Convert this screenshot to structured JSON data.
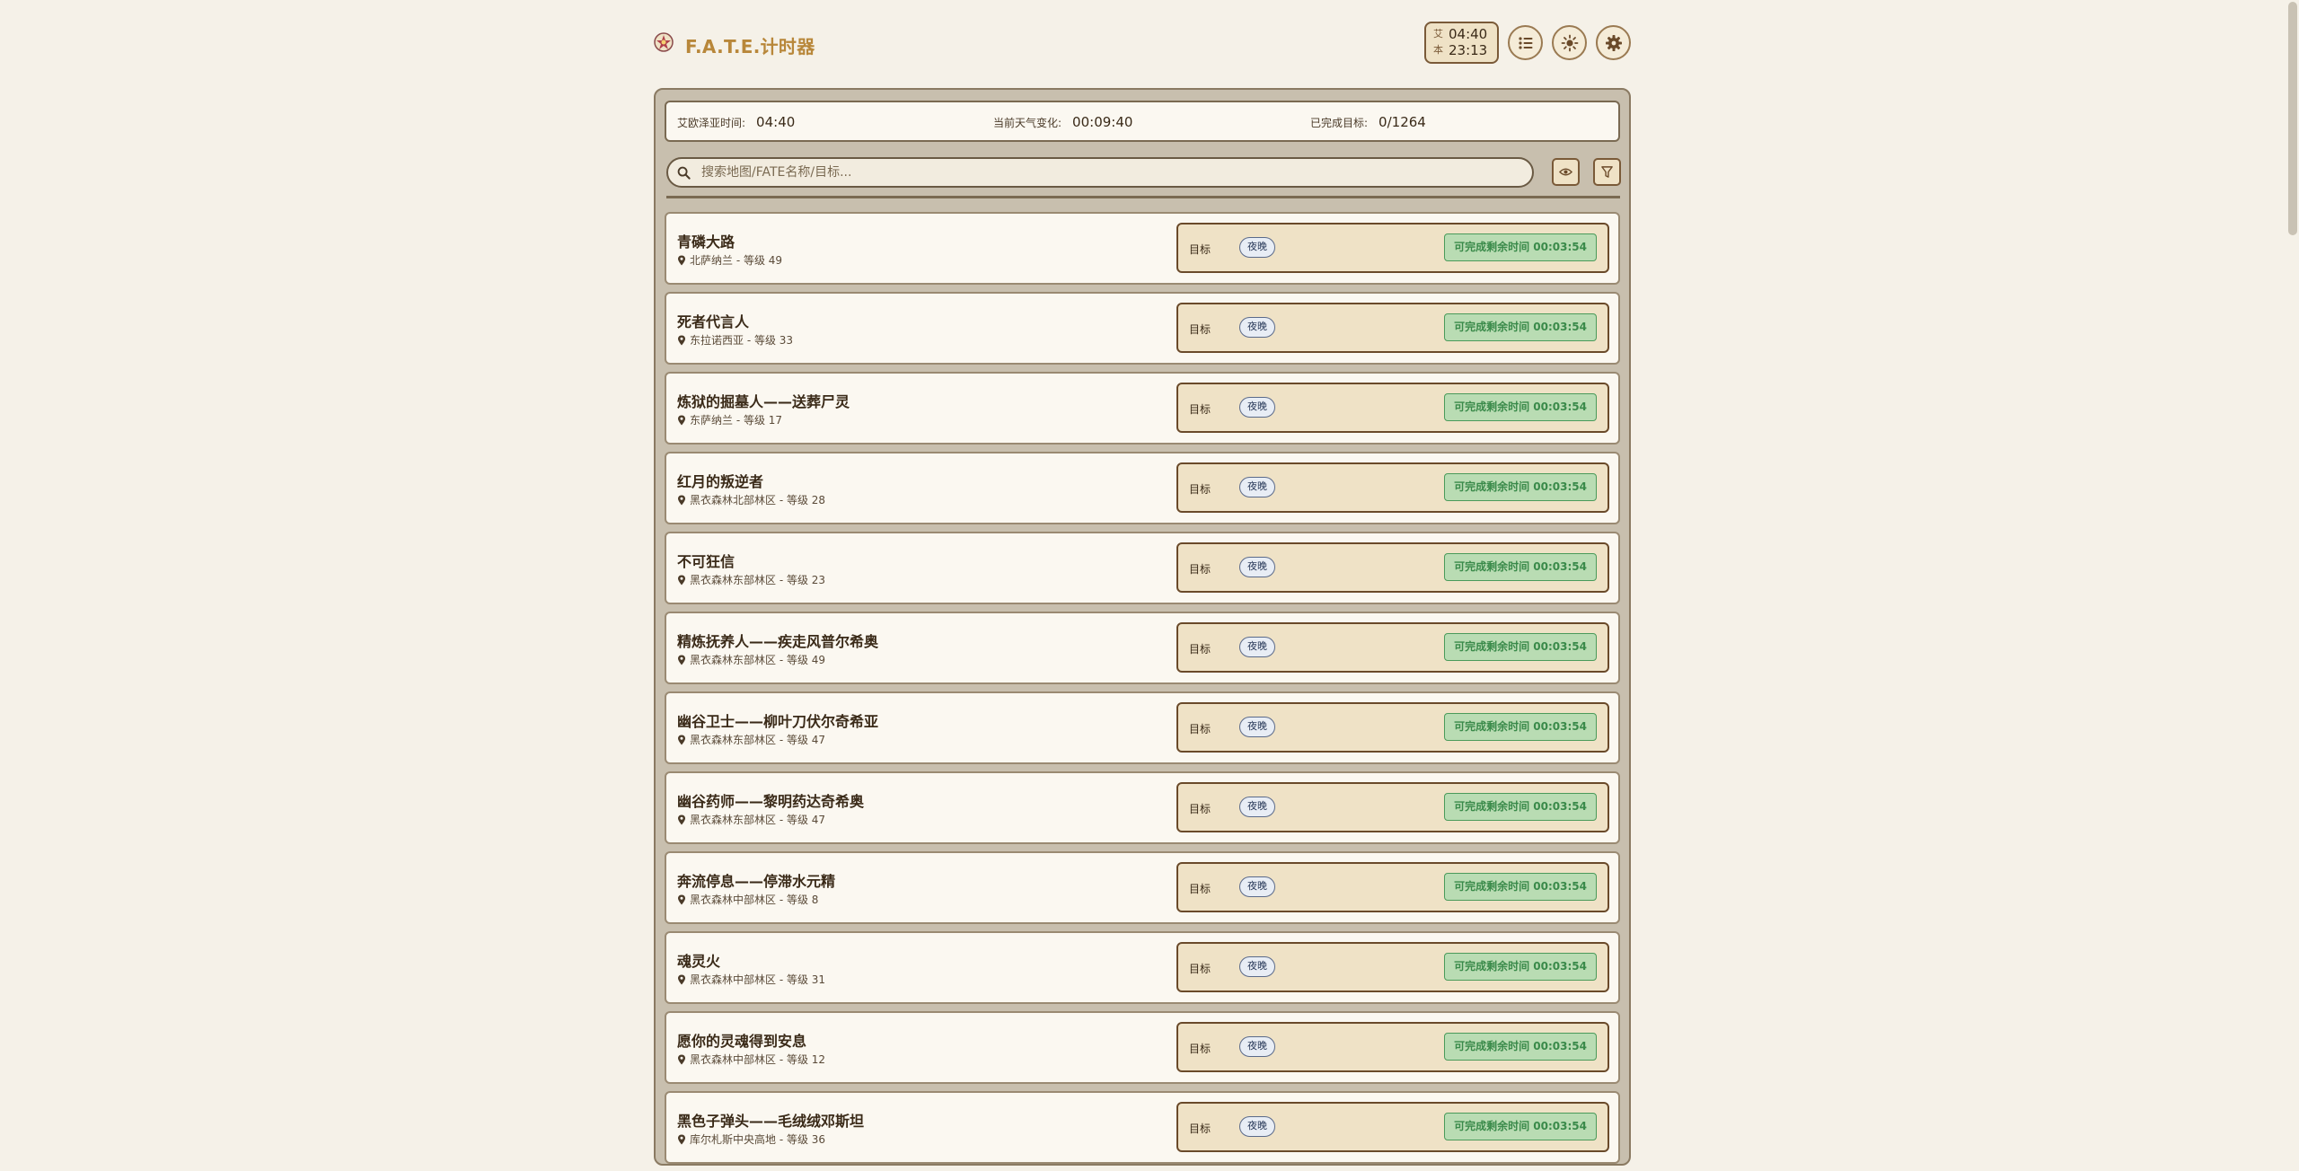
{
  "app": {
    "title": "F.A.T.E.计时器",
    "icon": "fate-logo-icon"
  },
  "header": {
    "clock": {
      "eorzea_label": "艾",
      "eorzea_time": "04:40",
      "local_label": "本",
      "local_time": "23:13"
    },
    "buttons": [
      {
        "name": "list-view-button",
        "icon": "list-icon"
      },
      {
        "name": "theme-toggle-button",
        "icon": "sun-icon"
      },
      {
        "name": "settings-button",
        "icon": "gear-icon"
      }
    ]
  },
  "info_bar": {
    "eorzea_time_label": "艾欧泽亚时间:",
    "eorzea_time_value": "04:40",
    "weather_change_label": "当前天气变化:",
    "weather_change_value": "00:09:40",
    "completed_label": "已完成目标:",
    "completed_value": "0/1264"
  },
  "search": {
    "placeholder": "搜索地图/FATE名称/目标..."
  },
  "colors": {
    "accent": "#b8873a",
    "remain_green": "#3a8a4a",
    "card_bg": "#fbf8f1",
    "condition_bg": "#efe2c6"
  },
  "fates": [
    {
      "name": "青磷大路",
      "location": "北萨纳兰 - 等级 49",
      "cond_label": "目标",
      "condition": "夜晚",
      "remain": "可完成剩余时间 00:03:54"
    },
    {
      "name": "死者代言人",
      "location": "东拉诺西亚 - 等级 33",
      "cond_label": "目标",
      "condition": "夜晚",
      "remain": "可完成剩余时间 00:03:54"
    },
    {
      "name": "炼狱的掘墓人——送葬尸灵",
      "location": "东萨纳兰 - 等级 17",
      "cond_label": "目标",
      "condition": "夜晚",
      "remain": "可完成剩余时间 00:03:54"
    },
    {
      "name": "红月的叛逆者",
      "location": "黑衣森林北部林区 - 等级 28",
      "cond_label": "目标",
      "condition": "夜晚",
      "remain": "可完成剩余时间 00:03:54"
    },
    {
      "name": "不可狂信",
      "location": "黑衣森林东部林区 - 等级 23",
      "cond_label": "目标",
      "condition": "夜晚",
      "remain": "可完成剩余时间 00:03:54"
    },
    {
      "name": "精炼抚养人——疾走风普尔希奥",
      "location": "黑衣森林东部林区 - 等级 49",
      "cond_label": "目标",
      "condition": "夜晚",
      "remain": "可完成剩余时间 00:03:54"
    },
    {
      "name": "幽谷卫士——柳叶刀伏尔奇希亚",
      "location": "黑衣森林东部林区 - 等级 47",
      "cond_label": "目标",
      "condition": "夜晚",
      "remain": "可完成剩余时间 00:03:54"
    },
    {
      "name": "幽谷药师——黎明药达奇希奥",
      "location": "黑衣森林东部林区 - 等级 47",
      "cond_label": "目标",
      "condition": "夜晚",
      "remain": "可完成剩余时间 00:03:54"
    },
    {
      "name": "奔流停息——停滞水元精",
      "location": "黑衣森林中部林区 - 等级 8",
      "cond_label": "目标",
      "condition": "夜晚",
      "remain": "可完成剩余时间 00:03:54"
    },
    {
      "name": "魂灵火",
      "location": "黑衣森林中部林区 - 等级 31",
      "cond_label": "目标",
      "condition": "夜晚",
      "remain": "可完成剩余时间 00:03:54"
    },
    {
      "name": "愿你的灵魂得到安息",
      "location": "黑衣森林中部林区 - 等级 12",
      "cond_label": "目标",
      "condition": "夜晚",
      "remain": "可完成剩余时间 00:03:54"
    },
    {
      "name": "黑色子弹头——毛绒绒邓斯坦",
      "location": "库尔札斯中央高地 - 等级 36",
      "cond_label": "目标",
      "condition": "夜晚",
      "remain": "可完成剩余时间 00:03:54"
    }
  ]
}
